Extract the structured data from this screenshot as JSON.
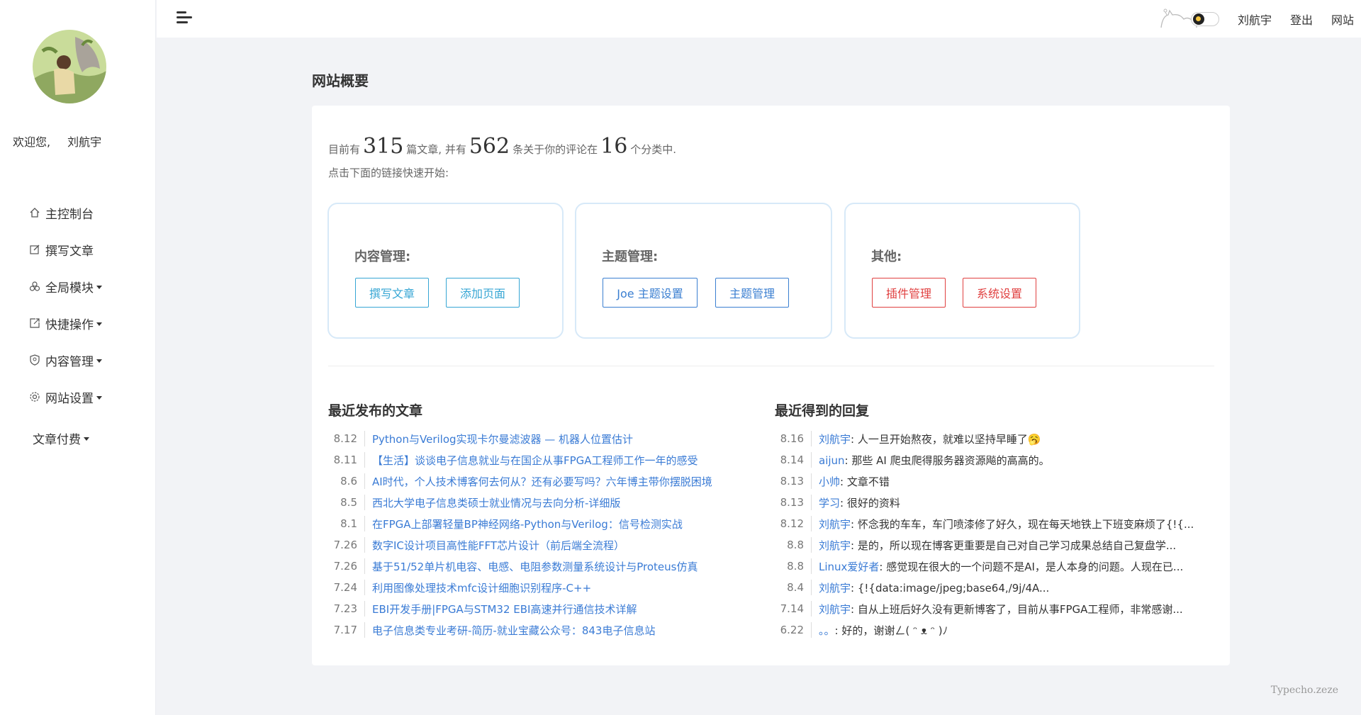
{
  "sidebar": {
    "welcome_prefix": "欢迎您,",
    "username": "刘航宇",
    "items": [
      {
        "label": "主控制台",
        "icon": "home-icon"
      },
      {
        "label": "撰写文章",
        "icon": "edit-icon"
      },
      {
        "label": "全局模块",
        "icon": "modules-icon"
      },
      {
        "label": "快捷操作",
        "icon": "external-edit-icon"
      },
      {
        "label": "内容管理",
        "icon": "shield-icon"
      },
      {
        "label": "网站设置",
        "icon": "gear-icon"
      },
      {
        "label": "文章付费",
        "icon": ""
      }
    ]
  },
  "topbar": {
    "user": "刘航宇",
    "logout": "登出",
    "site": "网站"
  },
  "main": {
    "title": "网站概要",
    "summary": {
      "prefix": "目前有",
      "posts": "315",
      "mid1": "篇文章, 并有",
      "comments": "562",
      "mid2": "条关于你的评论在",
      "categories": "16",
      "suffix": "个分类中."
    },
    "hint": "点击下面的链接快速开始:",
    "quick": [
      {
        "title": "内容管理:",
        "buttons": [
          "撰写文章",
          "添加页面"
        ]
      },
      {
        "title": "主题管理:",
        "buttons": [
          "Joe 主题设置",
          "主题管理"
        ]
      },
      {
        "title": "其他:",
        "buttons": [
          "插件管理",
          "系统设置"
        ]
      }
    ],
    "recent_posts_title": "最近发布的文章",
    "recent_posts": [
      {
        "date": "8.12",
        "title": "Python与Verilog实现卡尔曼滤波器 — 机器人位置估计"
      },
      {
        "date": "8.11",
        "title": "【生活】谈谈电子信息就业与在国企从事FPGA工程师工作一年的感受"
      },
      {
        "date": "8.6",
        "title": "AI时代，个人技术博客何去何从？还有必要写吗？六年博主带你摆脱困境"
      },
      {
        "date": "8.5",
        "title": "西北大学电子信息类硕士就业情况与去向分析-详细版"
      },
      {
        "date": "8.1",
        "title": "在FPGA上部署轻量BP神经网络-Python与Verilog：信号检测实战"
      },
      {
        "date": "7.26",
        "title": "数字IC设计项目高性能FFT芯片设计（前后端全流程）"
      },
      {
        "date": "7.26",
        "title": "基于51/52单片机电容、电感、电阻参数测量系统设计与Proteus仿真"
      },
      {
        "date": "7.24",
        "title": "利用图像处理技术mfc设计细胞识别程序-C++"
      },
      {
        "date": "7.23",
        "title": "EBI开发手册|FPGA与STM32 EBI高速并行通信技术详解"
      },
      {
        "date": "7.17",
        "title": "电子信息类专业考研-简历-就业宝藏公众号：843电子信息站"
      }
    ],
    "recent_replies_title": "最近得到的回复",
    "recent_replies": [
      {
        "date": "8.16",
        "author": "刘航宇",
        "text": ": 人一旦开始熬夜，就难以坚持早睡了🥱"
      },
      {
        "date": "8.14",
        "author": "aijun",
        "text": ": 那些 AI 爬虫爬得服务器资源飚的高高的。"
      },
      {
        "date": "8.13",
        "author": "小帅",
        "text": ": 文章不错"
      },
      {
        "date": "8.13",
        "author": "学习",
        "text": ": 很好的资料"
      },
      {
        "date": "8.12",
        "author": "刘航宇",
        "text": ": 怀念我的车车，车门喷漆修了好久，现在每天地铁上下班变麻烦了{!{..."
      },
      {
        "date": "8.8",
        "author": "刘航宇",
        "text": ": 是的，所以现在博客更重要是自己对自己学习成果总结自己复盘学..."
      },
      {
        "date": "8.8",
        "author": "Linux爱好者",
        "text": ": 感觉现在很大的一个问题不是AI，是人本身的问题。人现在已..."
      },
      {
        "date": "8.4",
        "author": "刘航宇",
        "text": ": {!{data:image/jpeg;base64,/9j/4A..."
      },
      {
        "date": "7.14",
        "author": "刘航宇",
        "text": ": 自从上班后好久没有更新博客了，目前从事FPGA工程师，非常感谢..."
      },
      {
        "date": "6.22",
        "author": "。。",
        "text": ": 好的，谢谢ㄥ( ᵔ ᴥ ᵔ )ﾉ"
      }
    ]
  },
  "footer": {
    "brand": "Typecho.zeze"
  }
}
